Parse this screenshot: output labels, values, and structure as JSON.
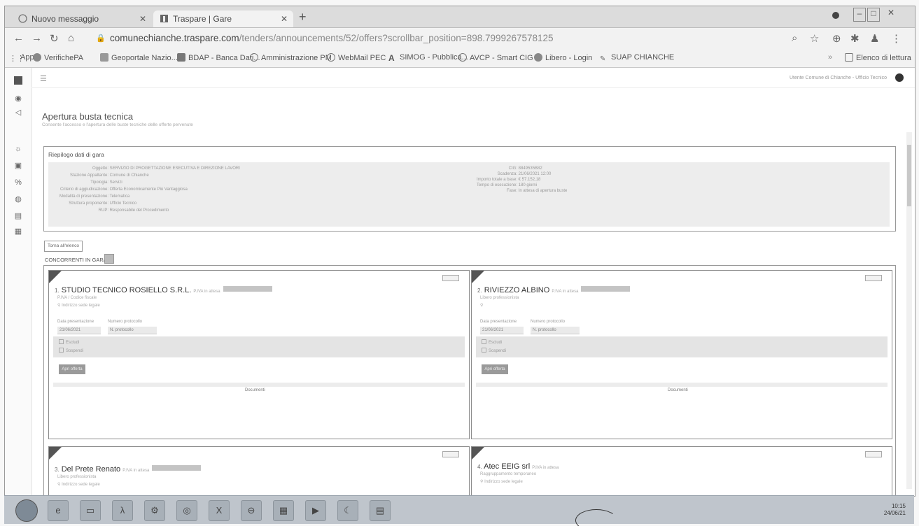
{
  "browser": {
    "tabs": [
      {
        "label": "Nuovo messaggio",
        "active": false
      },
      {
        "label": "Traspare | Gare",
        "active": true
      }
    ],
    "new_tab_symbol": "+",
    "url_host": "comunechianche.traspare.com",
    "url_path": "/tenders/announcements/52/offers?scrollbar_position=898.7999267578125",
    "bookmarks": [
      {
        "label": "App",
        "icon": "grid-icon"
      },
      {
        "label": "VerifichePA",
        "icon": "verifichepa-icon"
      },
      {
        "label": "Geoportale Nazio...",
        "icon": "geoportale-icon"
      },
      {
        "label": "BDAP - Banca Dati...",
        "icon": "bdap-icon"
      },
      {
        "label": "Amministrazione PM",
        "icon": "globe-icon"
      },
      {
        "label": "WebMail PEC",
        "icon": "globe-icon"
      },
      {
        "label": "SIMOG - Pubblica...",
        "icon": "simog-icon"
      },
      {
        "label": "AVCP - Smart CIG",
        "icon": "globe-icon"
      },
      {
        "label": "Libero - Login",
        "icon": "libero-icon"
      },
      {
        "label": "SUAP CHIANCHE",
        "icon": "suap-icon"
      }
    ],
    "reading_list": "Elenco di lettura",
    "more_symbol": "»"
  },
  "app": {
    "page_title": "Apertura busta tecnica",
    "page_subtitle": "Consente l'accesso e l'apertura delle buste tecniche delle offerte pervenute",
    "user_text": "Utente Comune di Chianche - Ufficio Tecnico",
    "summary_title": "Riepilogo dati di gara",
    "summary_left": [
      {
        "k": "Oggetto:",
        "v": "SERVIZIO DI PROGETTAZIONE ESECUTIVA E DIREZIONE LAVORI"
      },
      {
        "k": "Stazione Appaltante:",
        "v": "Comune di Chianche"
      },
      {
        "k": "Tipologia:",
        "v": "Servizi"
      },
      {
        "k": "Criterio di aggiudicazione:",
        "v": "Offerta Economicamente Più Vantaggiosa"
      },
      {
        "k": "Modalità di presentazione:",
        "v": "Telematica"
      },
      {
        "k": "Struttura proponente:",
        "v": "Ufficio Tecnico"
      },
      {
        "k": "RUP:",
        "v": "Responsabile del Procedimento"
      }
    ],
    "summary_right": [
      {
        "k": "CIG:",
        "v": "8849535B82"
      },
      {
        "k": "Scadenza:",
        "v": "21/06/2021 12:00"
      },
      {
        "k": "Importo totale a base:",
        "v": "€ 57.152,18"
      },
      {
        "k": "Tempo di esecuzione:",
        "v": "180 giorni"
      },
      {
        "k": "Fase:",
        "v": "In attesa di apertura buste"
      }
    ],
    "back_button": "Torna all'elenco",
    "competitors_label": "CONCORRENTI IN GARA:",
    "competitors": [
      {
        "num": "1.",
        "name": "STUDIO TECNICO ROSIELLO S.R.L.",
        "tag": "P.IVA in attesa",
        "sub": "P.IVA / Codice fiscale",
        "addr": "Indirizzo sede legale",
        "date_label": "Data presentazione",
        "date_value": "21/06/2021",
        "prot_label": "Numero protocollo",
        "prot_value": "N. protocollo",
        "radio1": "Escludi",
        "radio2": "Sospendi",
        "button": "Apri offerta",
        "link": "Documenti"
      },
      {
        "num": "2.",
        "name": "RIVIEZZO ALBINO",
        "tag": "P.IVA in attesa",
        "sub": "Libero professionista",
        "addr": "",
        "date_label": "Data presentazione",
        "date_value": "21/06/2021",
        "prot_label": "Numero protocollo",
        "prot_value": "N. protocollo",
        "radio1": "Escludi",
        "radio2": "Sospendi",
        "button": "Apri offerta",
        "link": "Documenti"
      },
      {
        "num": "3.",
        "name": "Del Prete Renato",
        "tag": "P.IVA in attesa",
        "sub": "Libero professionista",
        "addr": "Indirizzo sede legale"
      },
      {
        "num": "4.",
        "name": "Atec EEIG srl",
        "tag": "P.IVA in attesa",
        "sub": "Raggruppamento temporaneo",
        "addr": "Indirizzo sede legale"
      }
    ]
  },
  "taskbar": {
    "clock_time": "10:15",
    "clock_date": "24/06/21"
  }
}
